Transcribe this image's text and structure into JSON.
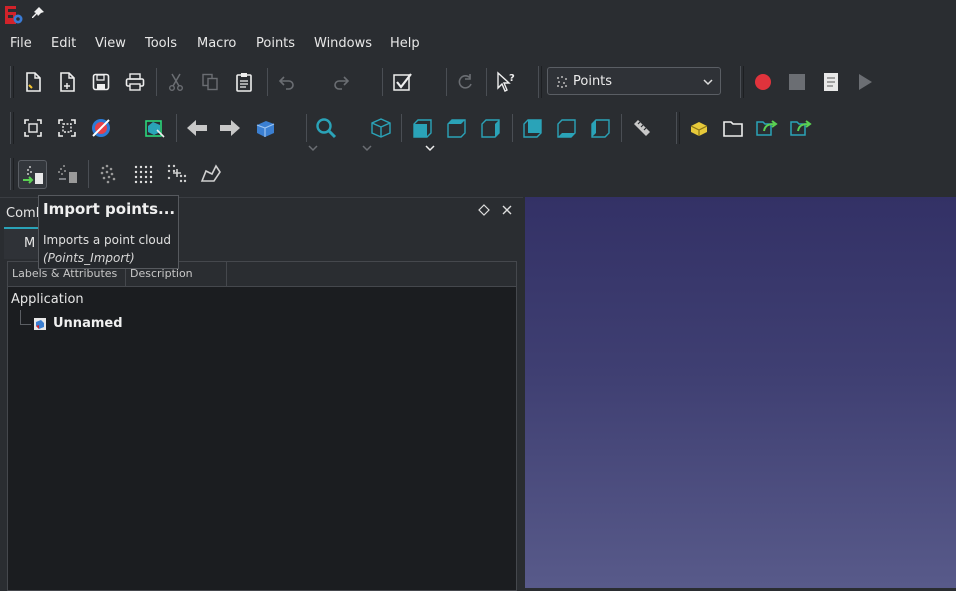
{
  "menu": [
    "File",
    "Edit",
    "View",
    "Tools",
    "Macro",
    "Points",
    "Windows",
    "Help"
  ],
  "workbench": {
    "label": "Points"
  },
  "combo_view": {
    "title": "Comb",
    "tab_model": "M"
  },
  "tree": {
    "headers": [
      "Labels & Attributes",
      "Description"
    ],
    "root": "Application",
    "document": "Unnamed"
  },
  "tooltip": {
    "title": "Import points...",
    "description": "Imports a point cloud",
    "command": "(Points_Import)"
  },
  "colors": {
    "accent": "#2aa3b8",
    "record": "#e0333c",
    "viewport_top": "#333166",
    "viewport_bottom": "#585a8a"
  }
}
